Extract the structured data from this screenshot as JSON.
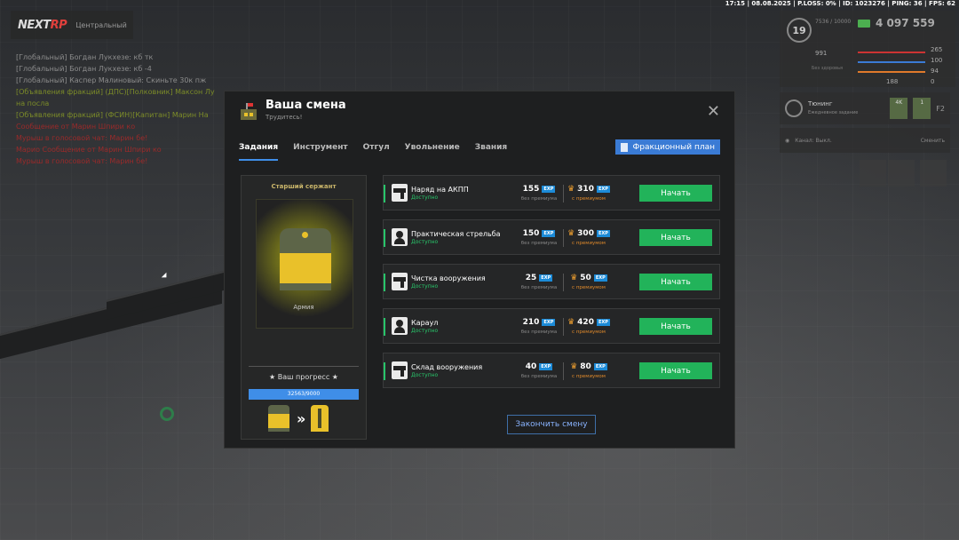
{
  "statusbar": "17:15 | 08.08.2025 | P.LOSS: 0% | ID: 1023276 | PING: 36 | FPS: 62",
  "logo": {
    "prefix": "NEXT",
    "suffix": "RP",
    "server": "Центральный"
  },
  "chat": [
    {
      "text": "[Глобальный] Богдан Лукхезе: кб тк",
      "color": "gray"
    },
    {
      "text": "[Глобальный] Богдан Лукхезе: кб -4",
      "color": "gray"
    },
    {
      "text": "[Глобальный] Каспер Малиновый: Скиньте 30к пж",
      "color": "gray"
    },
    {
      "text": "[Объявления фракций] (ДПС)[Полковник] Максон Лу",
      "color": "olive"
    },
    {
      "text": "на посла",
      "color": "olive"
    },
    {
      "text": "[Объявления фракций] (ФСИН)[Капитан] Марин На",
      "color": "olive"
    },
    {
      "text": "Сообщение от Марин Шпири ко",
      "color": "red"
    },
    {
      "text": "Мурыш в голосовой чат: Марин бе!",
      "color": "red"
    },
    {
      "text": "",
      "color": "red"
    },
    {
      "text": "Марио Сообщение от Марин Шпири ко",
      "color": "red"
    },
    {
      "text": "Мурыш в голосовой чат: Марин бе!",
      "color": "red"
    }
  ],
  "hud": {
    "level": "19",
    "exp": "7536 / 10000",
    "money": "4 097 559",
    "stat_a": "991",
    "stat_b_label": "Без здоровья",
    "health": "265",
    "mic": "100",
    "armor": "94",
    "ammo": "188",
    "shield": "0"
  },
  "tuning": {
    "title": "Тюнинг",
    "subtitle": "Ежедневное задание",
    "badge1": "4K",
    "badge2": "1",
    "key": "F2"
  },
  "channel": {
    "label": "Канал: Выкл.",
    "switch": "Сменить"
  },
  "modal": {
    "title": "Ваша смена",
    "subtitle": "Трудитесь!",
    "close": "✕",
    "tabs": [
      "Задания",
      "Инструмент",
      "Отгул",
      "Увольнение",
      "Звания"
    ],
    "faction_plan": "Фракционный план",
    "rank": {
      "name": "Старший сержант",
      "faction": "Армия"
    },
    "progress_label": "★ Ваш прогресс ★",
    "progress_text": "32563/9000",
    "progress_value": 1.0,
    "finish": "Закончить смену",
    "exp_badge": "EXP",
    "caption_no_premium": "без премиума",
    "caption_premium": "с премиумом",
    "start_label": "Начать",
    "tasks": [
      {
        "name": "Наряд на АКПП",
        "status": "Доступно",
        "base": "155",
        "premium": "310",
        "icon": "gun-icon"
      },
      {
        "name": "Практическая стрельба",
        "status": "Доступно",
        "base": "150",
        "premium": "300",
        "icon": "target-icon"
      },
      {
        "name": "Чистка вооружения",
        "status": "Доступно",
        "base": "25",
        "premium": "50",
        "icon": "gun-icon"
      },
      {
        "name": "Караул",
        "status": "Доступно",
        "base": "210",
        "premium": "420",
        "icon": "target-icon"
      },
      {
        "name": "Склад вооружения",
        "status": "Доступно",
        "base": "40",
        "premium": "80",
        "icon": "gun-icon"
      }
    ]
  }
}
